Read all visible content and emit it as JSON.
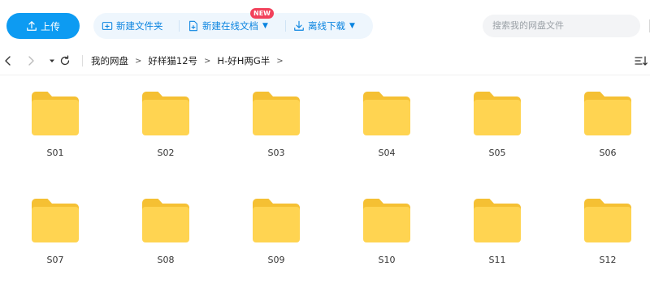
{
  "toolbar": {
    "upload_label": "上传",
    "new_folder_label": "新建文件夹",
    "new_online_doc_label": "新建在线文档",
    "new_badge": "NEW",
    "offline_download_label": "离线下载",
    "search_placeholder": "搜索我的网盘文件"
  },
  "breadcrumb": [
    "我的网盘",
    "好样猫12号",
    "H-好H两G半"
  ],
  "crumb_separator": ">",
  "folders": [
    {
      "name": "S01"
    },
    {
      "name": "S02"
    },
    {
      "name": "S03"
    },
    {
      "name": "S04"
    },
    {
      "name": "S05"
    },
    {
      "name": "S06"
    },
    {
      "name": "S07"
    },
    {
      "name": "S08"
    },
    {
      "name": "S09"
    },
    {
      "name": "S10"
    },
    {
      "name": "S11"
    },
    {
      "name": "S12"
    }
  ],
  "colors": {
    "accent": "#0d9bf2",
    "action_text": "#0a84e0",
    "folder_body": "#ffd451",
    "folder_tab": "#f5c033",
    "badge": "#f2415b"
  },
  "icons": {
    "upload": "upload-icon",
    "new_folder": "folder-plus-icon",
    "new_doc": "document-plus-icon",
    "offline_download": "download-icon",
    "back": "chevron-left-icon",
    "forward": "chevron-right-icon",
    "dropdown": "caret-down-icon",
    "refresh": "refresh-icon",
    "sort": "sort-icon",
    "folder": "folder-icon"
  }
}
